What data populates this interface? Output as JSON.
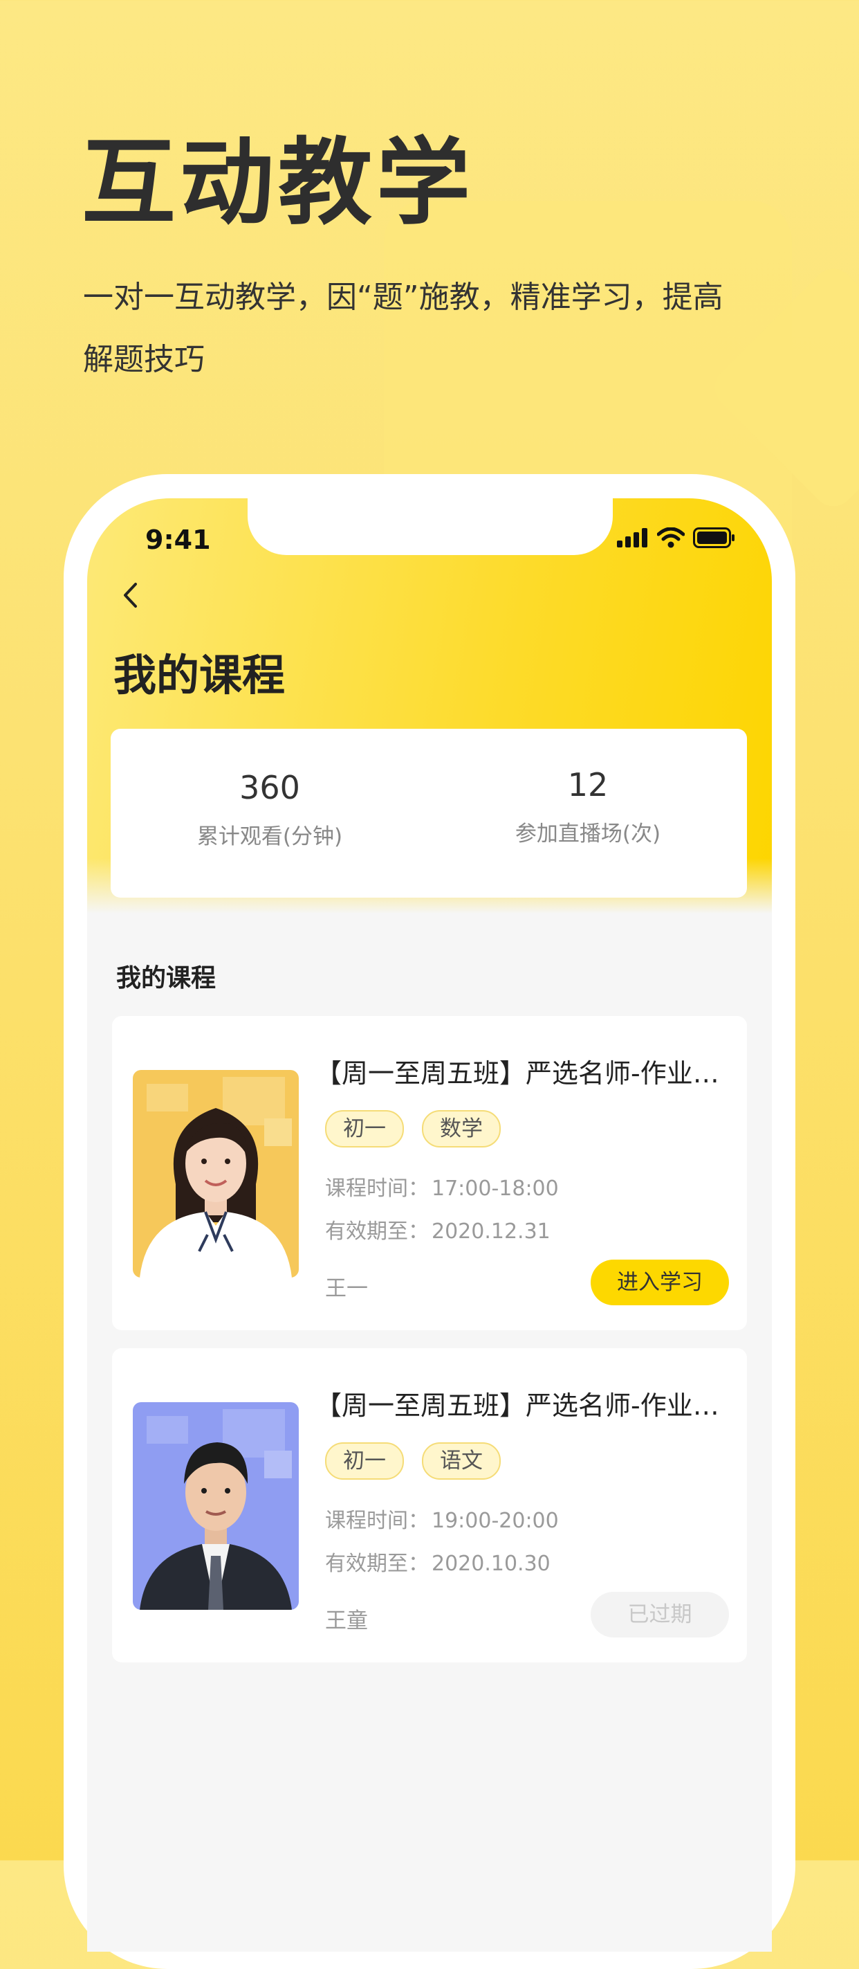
{
  "promo": {
    "headline": "互动教学",
    "subline": "一对一互动教学，因“题”施教，精准学习，提高解题技巧"
  },
  "status_bar": {
    "time": "9:41"
  },
  "page": {
    "title": "我的课程"
  },
  "stats": [
    {
      "value": "360",
      "label": "累计观看(分钟)"
    },
    {
      "value": "12",
      "label": "参加直播场(次)"
    }
  ],
  "section_title": "我的课程",
  "courses": [
    {
      "title": "【周一至周五班】严选名师-作业…",
      "tags": [
        "初一",
        "数学"
      ],
      "time_label": "课程时间：",
      "time_value": "17:00-18:00",
      "valid_label": "有效期至：",
      "valid_value": "2020.12.31",
      "teacher": "王一",
      "action": "进入学习",
      "status": "active"
    },
    {
      "title": "【周一至周五班】严选名师-作业…",
      "tags": [
        "初一",
        "语文"
      ],
      "time_label": "课程时间：",
      "time_value": "19:00-20:00",
      "valid_label": "有效期至：",
      "valid_value": "2020.10.30",
      "teacher": "王童",
      "action": "已过期",
      "status": "expired"
    }
  ],
  "colors": {
    "accent": "#fdd800",
    "tag_bg": "#fff6cc",
    "background": "#fce272"
  }
}
